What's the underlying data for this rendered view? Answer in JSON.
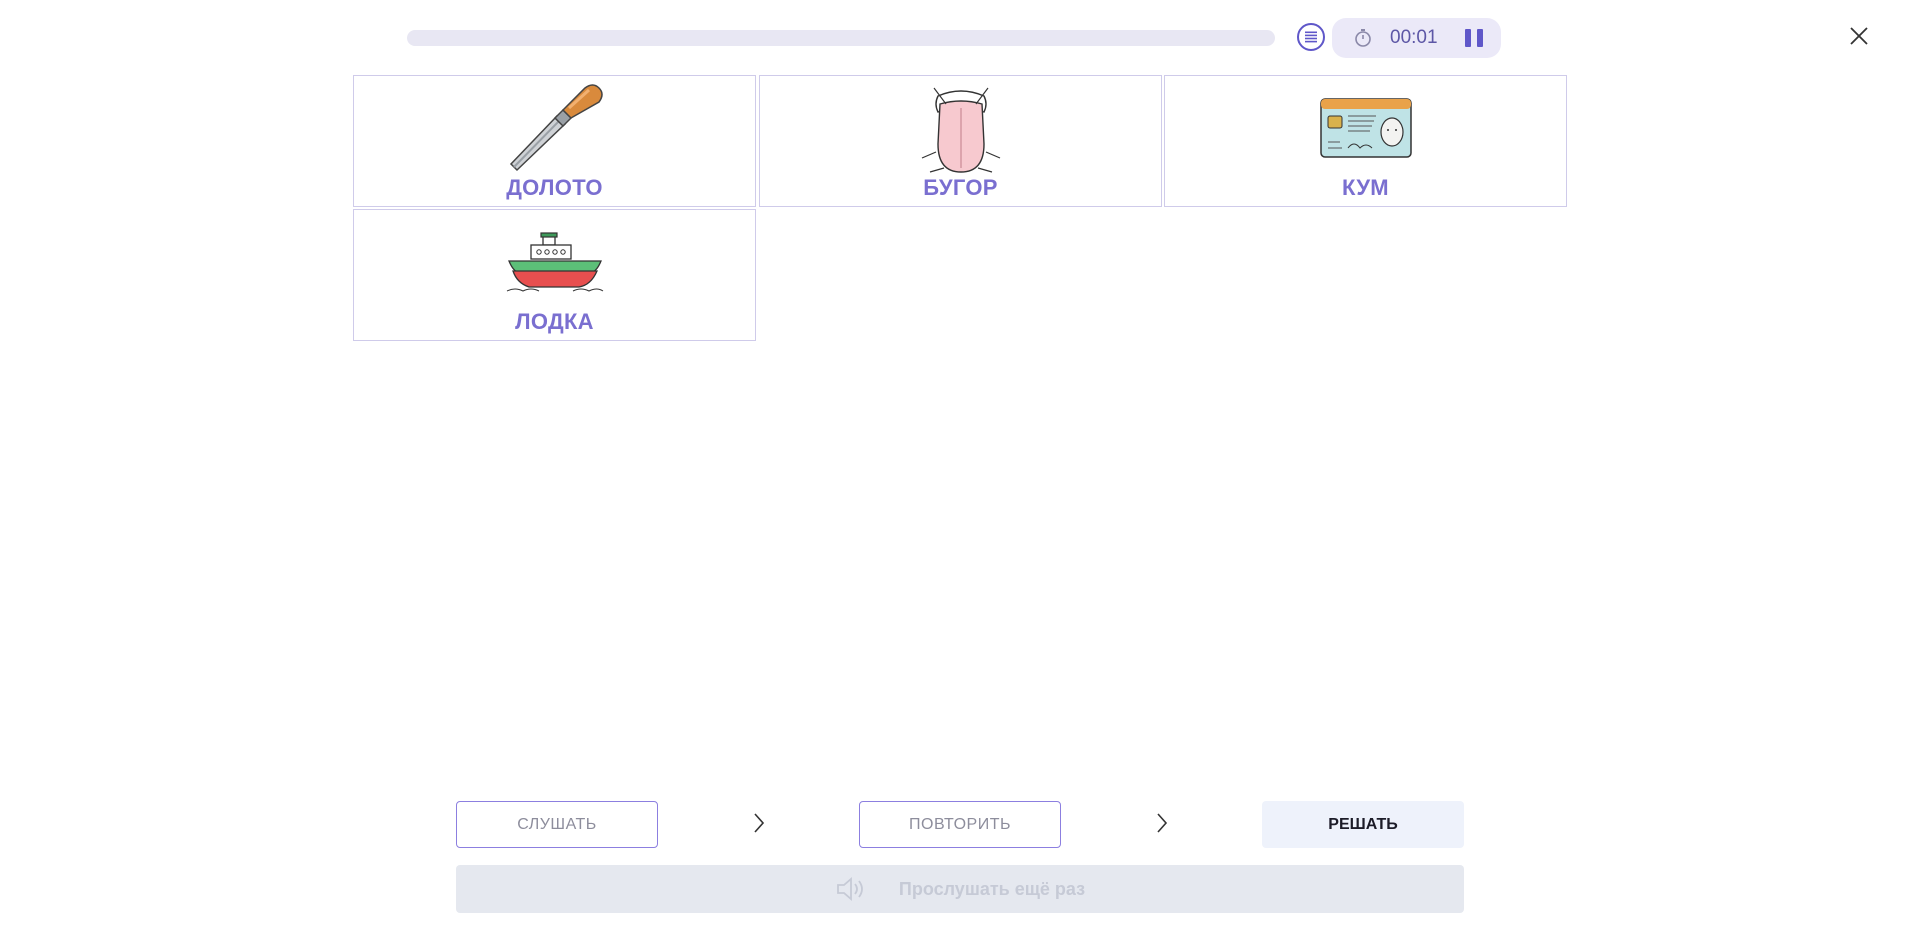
{
  "header": {
    "progress_fraction": 0,
    "timer": "00:01",
    "icons": {
      "list": "list-icon",
      "stopwatch": "stopwatch-icon",
      "pause": "pause-icon",
      "close": "close-icon"
    }
  },
  "cards": [
    {
      "word": "ДОЛОТО",
      "image": "chisel"
    },
    {
      "word": "БУГОР",
      "image": "tongue"
    },
    {
      "word": "КУМ",
      "image": "id-card"
    },
    {
      "word": "ЛОДКА",
      "image": "boat"
    }
  ],
  "controls": {
    "listen_label": "СЛУШАТЬ",
    "repeat_label": "ПОВТОРИТЬ",
    "solve_label": "РЕШАТЬ",
    "listen_again_label": "Прослушать ещё раз"
  },
  "colors": {
    "accent": "#7a6fd0",
    "progress_track": "#e8e7f3",
    "timer_bg": "#ebe9f8",
    "solve_bg": "#eef2fb",
    "listen_again_bg": "#e5e8ef"
  }
}
